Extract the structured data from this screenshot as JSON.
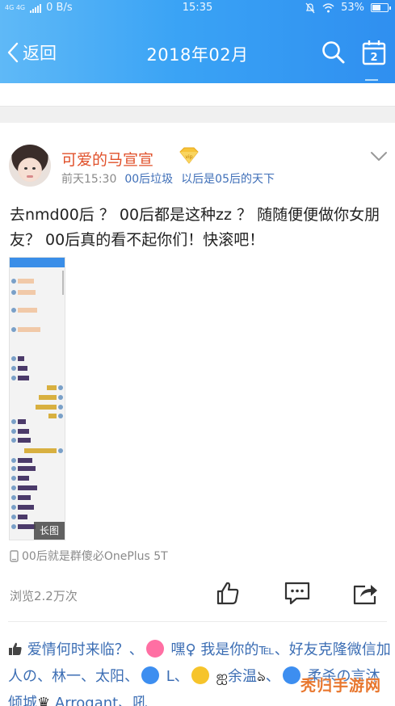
{
  "status_bar": {
    "network": "4G 4G",
    "speed": "0 B/s",
    "time": "15:35",
    "battery": "53%"
  },
  "nav": {
    "back_label": "返回",
    "title": "2018年02月",
    "calendar_day": "2"
  },
  "post": {
    "username": "可爱的马宣宣",
    "badge": "vip",
    "time": "前天15:30",
    "tags": [
      "00后垃圾",
      "以后是05后的天下"
    ],
    "content": "去nmd00后 ？  00后都是这种zz ？  随随便便做你女朋友？  00后真的看不起你们！快滚吧！",
    "image_tag": "长图",
    "device": "00后就是群傻必OnePlus 5T",
    "views": "浏览2.2万次"
  },
  "likes": {
    "names": [
      "爱情何时来临？",
      "嘿♀",
      "我是你的℡",
      "好友克隆微信加人の",
      "林一",
      "太阳",
      "L",
      "余温",
      "柔杀の言沐倾城",
      "Arrogant",
      "吼"
    ],
    "separator": "、"
  },
  "watermark": "秃归手游网",
  "colors": {
    "header_start": "#5fb9f7",
    "header_end": "#2f8ff0",
    "username": "#e0502a",
    "link": "#3c6eb4"
  }
}
